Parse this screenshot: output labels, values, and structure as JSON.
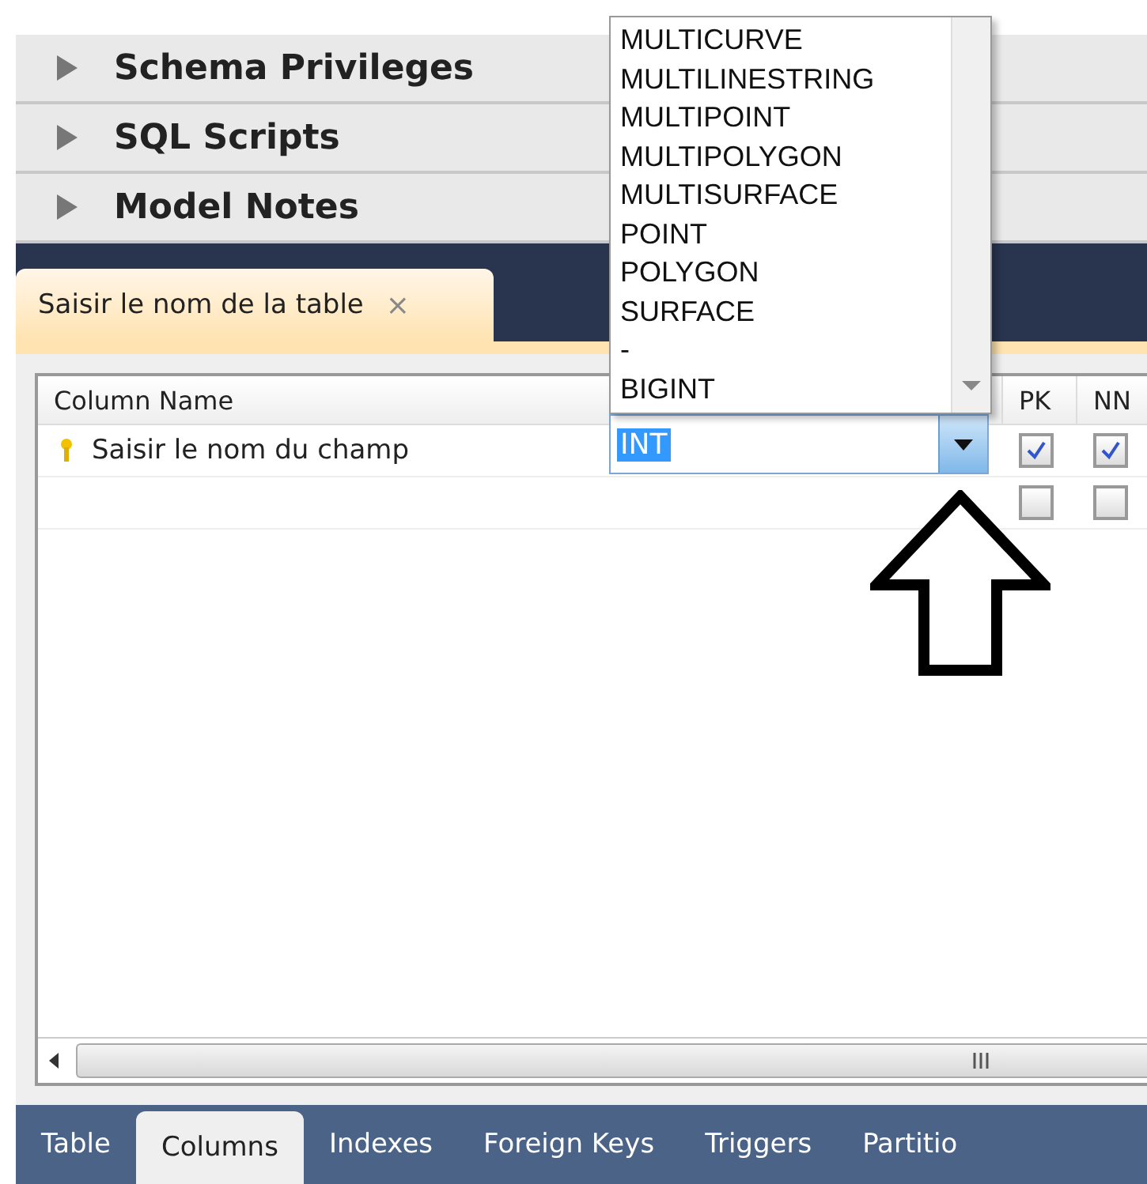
{
  "sections": [
    {
      "label": "Schema Privileges",
      "expanded": false
    },
    {
      "label": "SQL Scripts",
      "expanded": false
    },
    {
      "label": "Model Notes",
      "expanded": false
    }
  ],
  "editor_tab": {
    "label": "Saisir le nom de la table",
    "close": "×"
  },
  "table": {
    "columns": [
      "Column Name",
      "PK",
      "NN"
    ],
    "rows": [
      {
        "name": "Saisir le nom du champ",
        "primary_key": true,
        "pk": true,
        "nn": true
      },
      {
        "name": "",
        "primary_key": false,
        "pk": false,
        "nn": false
      }
    ]
  },
  "type_field": {
    "value": "INT"
  },
  "type_dropdown": {
    "options": [
      "MULTICURVE",
      "MULTILINESTRING",
      "MULTIPOINT",
      "MULTIPOLYGON",
      "MULTISURFACE",
      "POINT",
      "POLYGON",
      "SURFACE",
      "-",
      "BIGINT"
    ]
  },
  "bottom_tabs": [
    {
      "label": "Table",
      "selected": false
    },
    {
      "label": "Columns",
      "selected": true
    },
    {
      "label": "Indexes",
      "selected": false
    },
    {
      "label": "Foreign Keys",
      "selected": false
    },
    {
      "label": "Triggers",
      "selected": false
    },
    {
      "label": "Partitio",
      "selected": false
    }
  ]
}
